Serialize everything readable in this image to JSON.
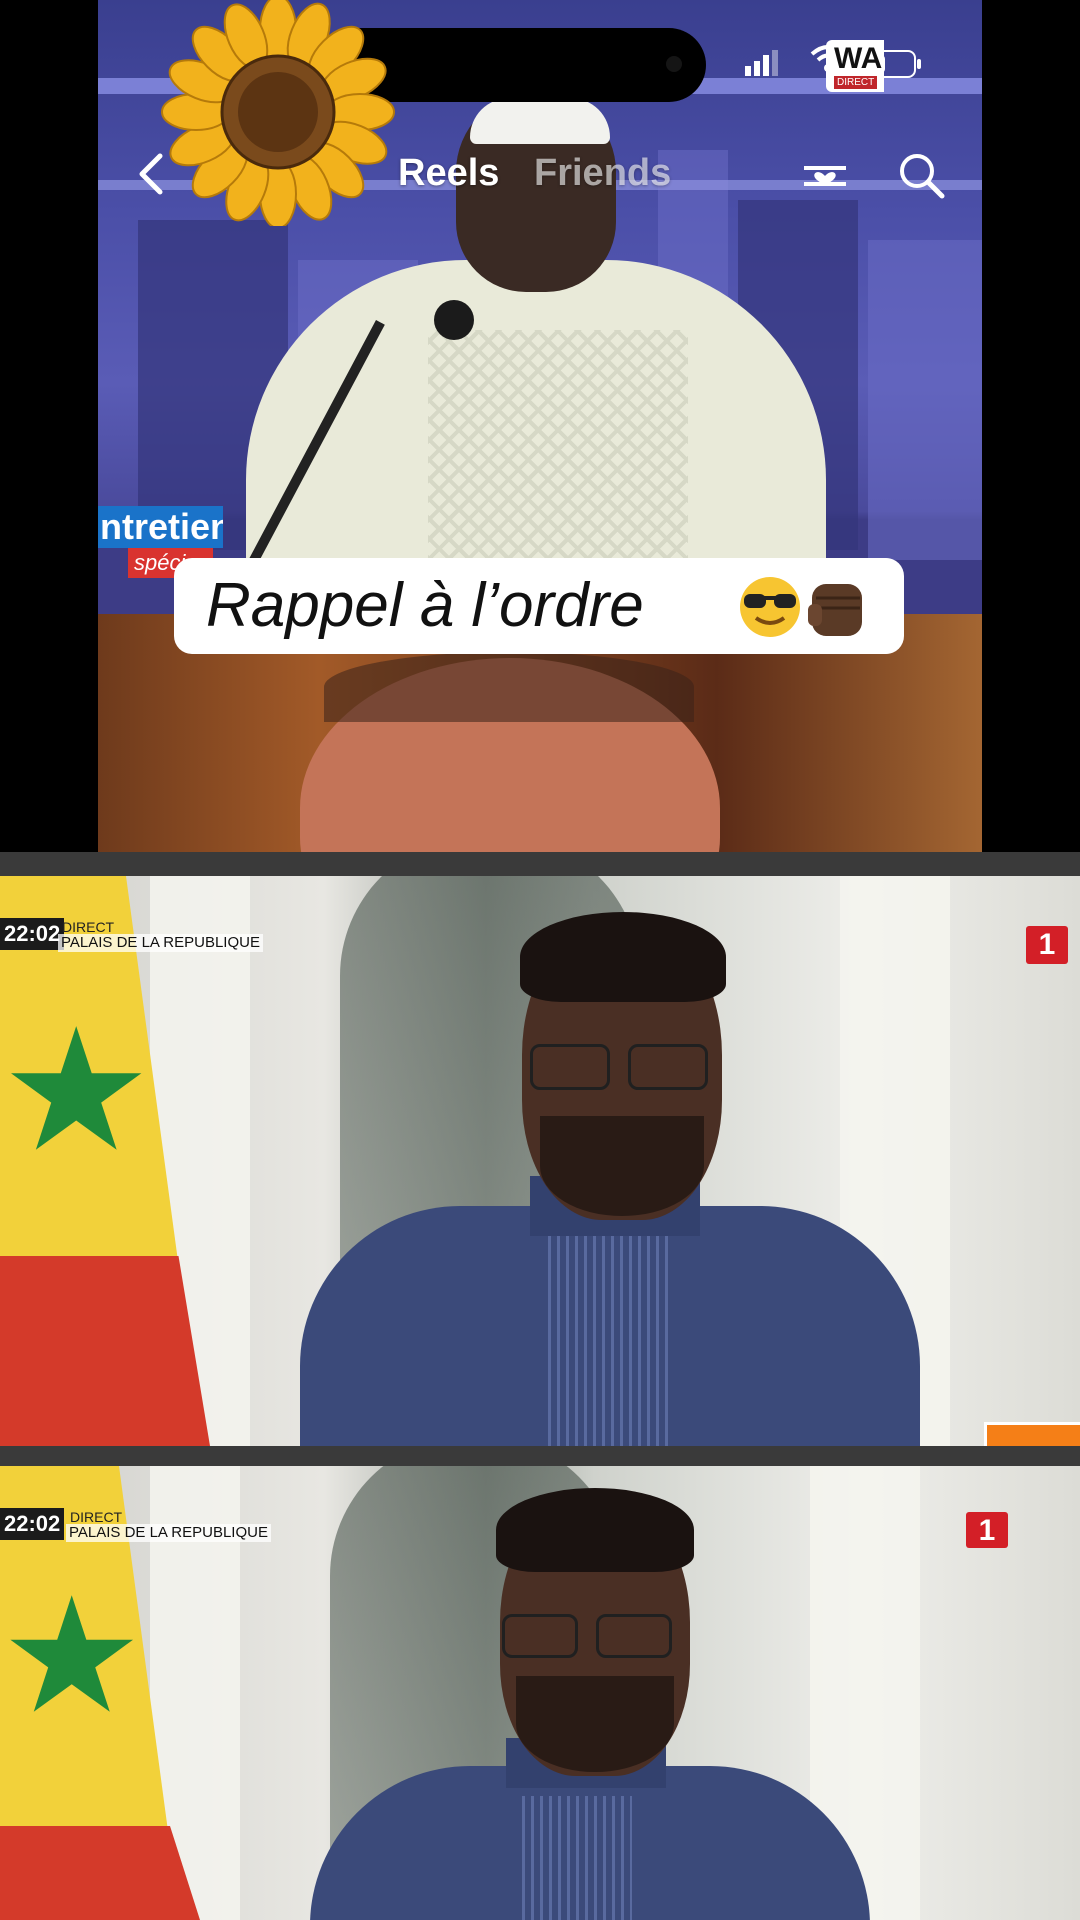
{
  "status_bar": {
    "channel_logo_name": "WAL",
    "channel_logo_tag": "DIRECT"
  },
  "reels_header": {
    "tab_reels": "Reels",
    "tab_friends": "Friends",
    "back_icon": "chevron-left-icon",
    "filter_icon": "heart-filter-icon",
    "search_icon": "search-icon",
    "sticker": "sunflower"
  },
  "video1": {
    "tv_badge_title": "ntretien",
    "tv_badge_sub": "spéci",
    "caption": "Rappel à l’ordre",
    "caption_emojis": [
      "smiling-face-with-sunglasses",
      "raised-fist-dark-skin"
    ]
  },
  "broadcast": [
    {
      "time": "22:02",
      "direct": "DIRECT",
      "location": "PALAIS DE LA REPUBLIQUE",
      "channel_number": "1"
    },
    {
      "time": "22:02",
      "direct": "DIRECT",
      "location": "PALAIS DE LA REPUBLIQUE",
      "channel_number": "1"
    }
  ],
  "colors": {
    "caption_bg": "#ffffff",
    "broadcast_logo": "#d31f27",
    "studio_purple": "#4b4fa8"
  }
}
